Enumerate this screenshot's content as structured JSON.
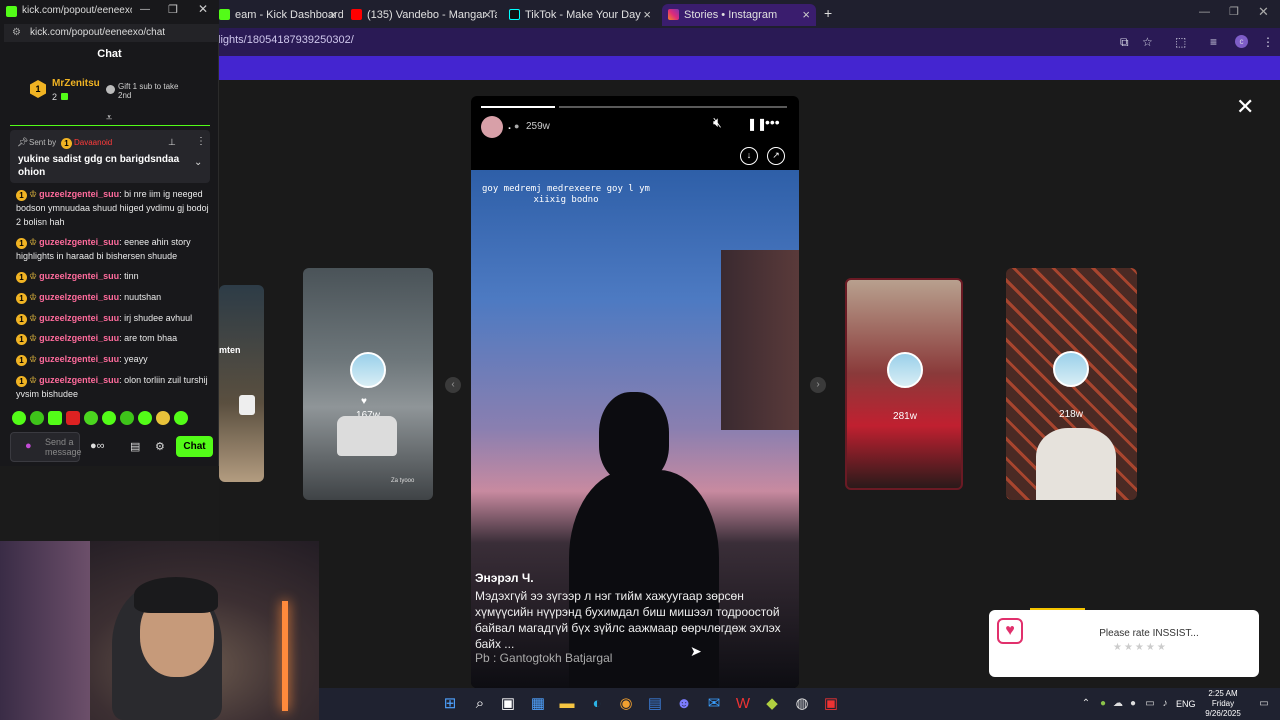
{
  "browser": {
    "tabs": [
      {
        "label": "kick.com/popout/eeneexo/c...",
        "color": "#53fc18"
      },
      {
        "label": "eam - Kick Dashboard",
        "color": "#53fc18"
      },
      {
        "label": "(135) Vandebo - Mangar Ta",
        "color": "#ff0000"
      },
      {
        "label": "TikTok - Make Your Day",
        "color": "#111111"
      },
      {
        "label": "Stories • Instagram",
        "color": "#e1306c"
      }
    ],
    "url": "lights/18054187939250302/",
    "new_tab": "+"
  },
  "chat": {
    "popout_url": "kick.com/popout/eeneexo/chat",
    "title": "Chat",
    "top_gifter": {
      "name": "MrZenitsu",
      "count": "2",
      "gift_hint": "Gift 1 sub to take 2nd"
    },
    "pinned": {
      "sent_by_label": "Sent by",
      "sender": "Davaanoid",
      "text": "yukine sadist gdg cn barigdsndaa ohion"
    },
    "messages": [
      {
        "user": "guzeelzgentei_suu",
        "text": ": bi nre iim ig neeged bodson ymnuudaa shuud hiiged yvdimu gj bodoj 2 bolisn hah"
      },
      {
        "user": "guzeelzgentei_suu",
        "text": ": eenee ahin story highlights in haraad bi bishersen shuude"
      },
      {
        "user": "guzeelzgentei_suu",
        "text": ": tinn"
      },
      {
        "user": "guzeelzgentei_suu",
        "text": ": nuutshan"
      },
      {
        "user": "guzeelzgentei_suu",
        "text": ": irj shudee avhuul"
      },
      {
        "user": "guzeelzgentei_suu",
        "text": ": are tom bhaa"
      },
      {
        "user": "guzeelzgentei_suu",
        "text": ": yeayy"
      },
      {
        "user": "guzeelzgentei_suu",
        "text": ": olon torliin zuil turshij yvsim bishudee"
      }
    ],
    "input_placeholder": "Send a message",
    "send_label": "Chat"
  },
  "story": {
    "username": ".",
    "age": "259w",
    "overlay_text": "goy medremj medrexeere goy l ym xiixig bodno",
    "caption_author": "Энэрэл Ч.",
    "caption_body": "Мэдэхгүй ээ зүгээр л нэг тийм хажуугаар зөрсөн хүмүүсийн нүүрэнд бухимдал биш мишээл тодроостой байвал магадгүй бүх зүйлс аажмаар өөрчлөгдөж эхлэх байх ...",
    "caption_credit": "Pb : Gantogtokh Batjargal"
  },
  "side_stories": [
    {
      "age": "167w",
      "label": "Za tyooo"
    },
    {
      "age": "281w"
    },
    {
      "age": "218w"
    }
  ],
  "left_card_text": "mten",
  "rate_popup": {
    "text": "Please rate INSSIST..."
  },
  "taskbar": {
    "lang": "ENG",
    "time": "2:25 AM",
    "day": "Friday",
    "date": "9/26/2025"
  }
}
